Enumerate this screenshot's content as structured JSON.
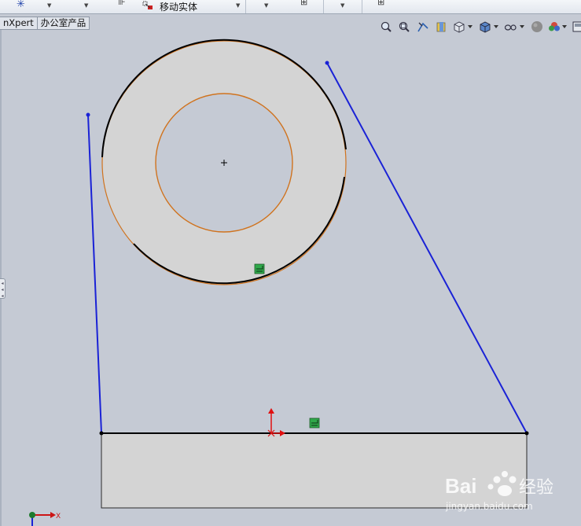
{
  "ribbon": {
    "move_body_label": "移动实体"
  },
  "tabs": [
    {
      "label": "nXpert"
    },
    {
      "label": "办公室产品"
    }
  ],
  "viewbar": {
    "icons": [
      "zoom-to-fit-icon",
      "zoom-area-icon",
      "previous-view-icon",
      "section-view-icon",
      "view-orientation-icon",
      "display-style-icon",
      "hide-show-items-icon",
      "edit-appearance-icon",
      "apply-scene-icon",
      "view-settings-icon"
    ]
  },
  "sketch": {
    "colors": {
      "construction_line": "#1a22d6",
      "outer_edge": "#000000",
      "face_fill": "#d4d4d4",
      "circle_edge": "#d0731e",
      "origin_axis": "#e01010"
    }
  },
  "watermark": {
    "brand": "Bai",
    "brand_suffix": "经验",
    "url": "jingyan.baidu.com"
  },
  "triad": {
    "x_label": "X"
  }
}
